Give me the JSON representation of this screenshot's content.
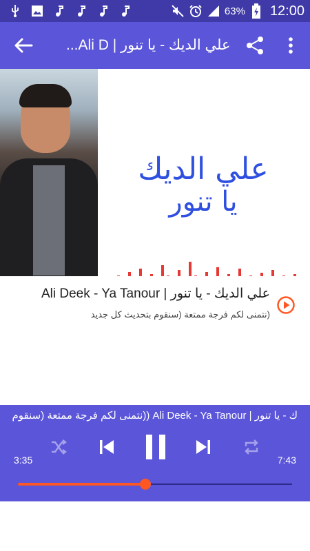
{
  "status_bar": {
    "battery_percent": "63%",
    "time": "12:00",
    "left_icons": [
      "usb-icon",
      "image-icon",
      "music-note-icon",
      "music-note-icon",
      "music-note-icon",
      "music-note-icon"
    ],
    "right_icons": [
      "mute-icon",
      "alarm-icon",
      "signal-icon",
      "battery-charging-icon"
    ]
  },
  "toolbar": {
    "title": "علي الديك - يا تنور | Ali D...",
    "back_icon": "arrow-left-icon",
    "share_icon": "share-icon",
    "more_icon": "more-vert-icon"
  },
  "album_art": {
    "line1": "علي الديك",
    "line2": "يا تنور"
  },
  "track": {
    "title": "علي الديك - يا تنور | Ali Deek - Ya Tanour",
    "subtitle": "(نتمنى لكم فرجة ممتعة (سنقوم بتحديث كل جديد",
    "play_icon": "play-circle-icon"
  },
  "player": {
    "marquee": "ك - يا تنور | Ali Deek - Ya Tanour ((نتمنى لكم فرجة ممتعة (سنقوم بتحديث كل",
    "current_time": "3:35",
    "total_time": "7:43",
    "progress": 0.465,
    "accent_color": "#ff5722",
    "controls": [
      "shuffle-icon",
      "skip-previous-icon",
      "pause-icon",
      "skip-next-icon",
      "repeat-icon"
    ]
  },
  "colors": {
    "status_bar": "#3f3aa8",
    "primary": "#5b55d9"
  }
}
